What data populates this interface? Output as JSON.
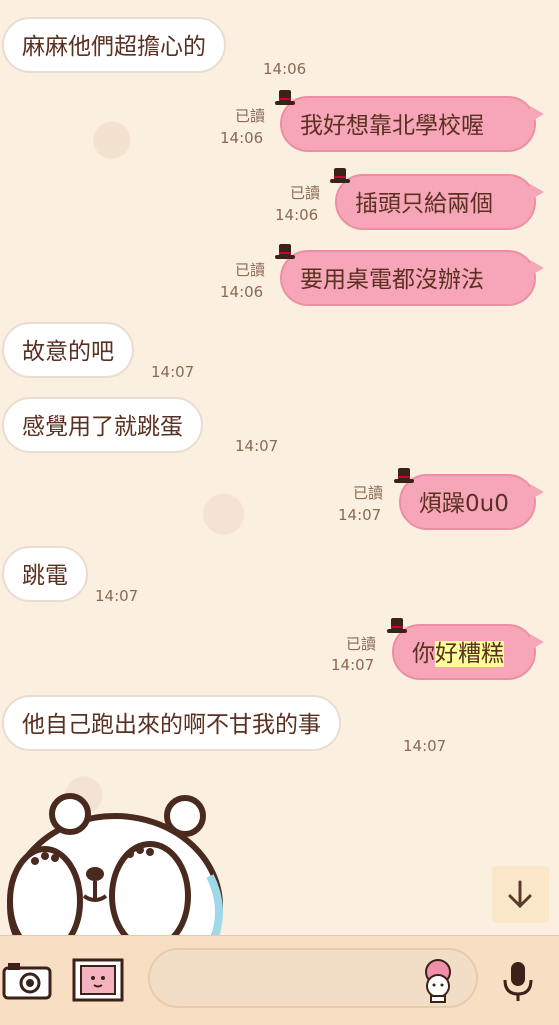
{
  "messages": [
    {
      "side": "in",
      "text": "麻麻他們超擔心的",
      "time": "14:06"
    },
    {
      "side": "out",
      "text": "我好想靠北學校喔",
      "time": "14:06",
      "read": "已讀"
    },
    {
      "side": "out",
      "text": "插頭只給兩個",
      "time": "14:06",
      "read": "已讀"
    },
    {
      "side": "out",
      "text": "要用桌電都沒辦法",
      "time": "14:06",
      "read": "已讀"
    },
    {
      "side": "in",
      "text": "故意的吧",
      "time": "14:07"
    },
    {
      "side": "in",
      "text": "感覺用了就跳蛋",
      "time": "14:07"
    },
    {
      "side": "out",
      "text": "煩躁0u0",
      "time": "14:07",
      "read": "已讀"
    },
    {
      "side": "in",
      "text": "跳電",
      "time": "14:07"
    },
    {
      "side": "out",
      "text_pre": "你",
      "text_hl": "好糟糕",
      "time": "14:07",
      "read": "已讀"
    },
    {
      "side": "in",
      "text": "他自己跑出來的啊不甘我的事",
      "time": "14:07"
    }
  ],
  "icons": {
    "camera": "camera-icon",
    "photo": "photo-icon",
    "sticker": "sticker-icon",
    "mic": "microphone-icon",
    "scroll": "arrow-down-icon"
  },
  "colors": {
    "outgoing": "#f6a6b8",
    "incoming": "#ffffff",
    "background": "#fbefdf",
    "highlight": "#ffff99"
  }
}
